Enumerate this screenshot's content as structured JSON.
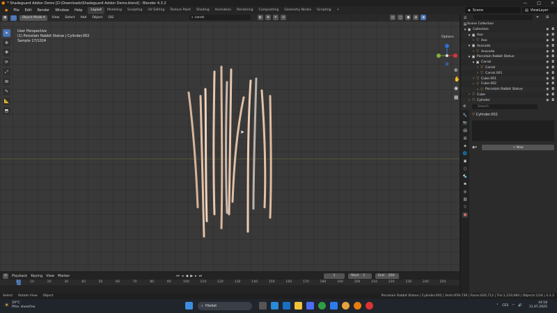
{
  "window": {
    "title": "* Shadeguard Addon Demo [D:\\Downloads\\Shadeguard Addon Demo.blend] - Blender 4.3.2",
    "controls": [
      "—",
      "□",
      "✕"
    ]
  },
  "menu": {
    "items": [
      "File",
      "Edit",
      "Render",
      "Window",
      "Help"
    ],
    "workspaces": [
      "Layout",
      "Modeling",
      "Sculpting",
      "UV Editing",
      "Texture Paint",
      "Shading",
      "Animation",
      "Rendering",
      "Compositing",
      "Geometry Nodes",
      "Scripting"
    ],
    "active_workspace": "Layout",
    "add_tab": "+",
    "scene_label": "Scene",
    "viewlayer_label": "ViewLayer"
  },
  "viewport": {
    "mode": "Object Mode",
    "menus": [
      "View",
      "Select",
      "Add",
      "Object",
      "GIS"
    ],
    "transform_orientation": "Global",
    "search_value": "carrot",
    "info_line1": "User Perspective",
    "info_line2": "(1) Porcelain Rabbit Statue | Cylinder.002",
    "info_line3": "Sample 17/1024",
    "options_label": "Options",
    "tool_icons": [
      "select-icon",
      "cursor-icon",
      "move-icon",
      "rotate-icon",
      "scale-icon",
      "transform-icon",
      "annotate-icon",
      "measure-icon",
      "add-cube-icon"
    ]
  },
  "timeline": {
    "menus": [
      "Playback",
      "Keying",
      "View",
      "Marker"
    ],
    "current_frame": "1",
    "start_label": "Start",
    "start_value": "1",
    "end_label": "End",
    "end_value": "250",
    "ticks": [
      "1",
      "10",
      "20",
      "30",
      "40",
      "50",
      "60",
      "70",
      "80",
      "90",
      "100",
      "110",
      "120",
      "130",
      "140",
      "150",
      "160",
      "170",
      "180",
      "190",
      "200",
      "210",
      "220",
      "230",
      "240",
      "250"
    ]
  },
  "statusbar": {
    "left": [
      "Select",
      "Rotate View",
      "Object"
    ],
    "right": "Porcelain Rabbit Statue | Cylinder.002 | Verts:659,736 | Faces:620,712 | Tris:1,219,084 | Objects:1/24 | 4.3.2"
  },
  "outliner": {
    "root": "Scene Collection",
    "rows": [
      {
        "label": "Collection",
        "indent": 0,
        "icon": "collection-icon"
      },
      {
        "label": "Axo",
        "indent": 1,
        "icon": "collection-icon"
      },
      {
        "label": "Axo",
        "indent": 2,
        "icon": "object-icon"
      },
      {
        "label": "Avocado",
        "indent": 1,
        "icon": "collection-icon"
      },
      {
        "label": "Avocado",
        "indent": 2,
        "icon": "object-icon"
      },
      {
        "label": "Porcelain Rabbit Statue",
        "indent": 1,
        "icon": "collection-icon"
      },
      {
        "label": "Carrot",
        "indent": 2,
        "icon": "collection-icon"
      },
      {
        "label": "Carrot",
        "indent": 3,
        "icon": "object-icon"
      },
      {
        "label": "Carrot.001",
        "indent": 3,
        "icon": "object-icon"
      },
      {
        "label": "Cube.001",
        "indent": 2,
        "icon": "object-icon"
      },
      {
        "label": "Cube.002",
        "indent": 2,
        "icon": "object-icon"
      },
      {
        "label": "Porcelain Rabbit Statue",
        "indent": 3,
        "icon": "object-icon"
      },
      {
        "label": "Cube",
        "indent": 1,
        "icon": "object-icon"
      },
      {
        "label": "Cylinder",
        "indent": 1,
        "icon": "object-icon"
      }
    ]
  },
  "properties": {
    "search_placeholder": "Search",
    "object_name": "Cylinder.002",
    "new_button": "New",
    "add_icon": "+"
  },
  "taskbar": {
    "temperature": "20°C",
    "weather": "Přev. slunečno",
    "search_label": "Hledat",
    "language": "CES",
    "time": "14:18",
    "date": "11.07.2025"
  },
  "chart_data": {
    "type": "table",
    "note_colors": {
      "accent": "#4772b3",
      "selected_row": "#334d80",
      "carrot": "#e8c4a8"
    }
  }
}
